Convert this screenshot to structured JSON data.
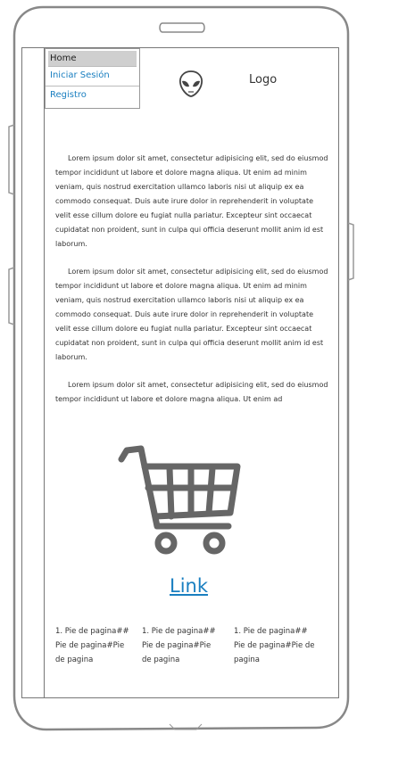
{
  "menu": {
    "items": [
      {
        "label": "Home"
      },
      {
        "label": "Iniciar Sesión"
      },
      {
        "label": "Registro"
      }
    ]
  },
  "header": {
    "logo_text": "Logo",
    "logo_icon": "alien-icon"
  },
  "main": {
    "paragraphs": [
      "Lorem ipsum dolor sit amet, consectetur adipisicing elit, sed do eiusmod tempor incididunt ut labore et dolore magna aliqua. Ut enim ad minim veniam, quis nostrud exercitation ullamco laboris nisi ut aliquip ex ea commodo consequat. Duis aute irure dolor in reprehenderit in voluptate velit esse cillum dolore eu fugiat nulla pariatur. Excepteur sint occaecat cupidatat non proident, sunt in culpa qui officia deserunt mollit anim id est laborum.",
      "Lorem ipsum dolor sit amet, consectetur adipisicing elit, sed do eiusmod tempor incididunt ut labore et dolore magna aliqua. Ut enim ad minim veniam, quis nostrud exercitation ullamco laboris nisi ut aliquip ex ea commodo consequat. Duis aute irure dolor in reprehenderit in voluptate velit esse cillum dolore eu fugiat nulla pariatur. Excepteur sint occaecat cupidatat non proident, sunt in culpa qui officia deserunt mollit anim id est laborum.",
      "Lorem ipsum dolor sit amet, consectetur adipisicing elit, sed do eiusmod tempor incididunt ut labore et dolore magna aliqua. Ut enim ad"
    ],
    "cart_icon": "shopping-cart-icon",
    "link_label": "Link"
  },
  "footer": {
    "columns": [
      "1. Pie de pagina## Pie de pagina#Pie de pagina",
      "1. Pie de pagina## Pie de pagina#Pie de pagina",
      "1. Pie de pagina## Pie de pagina#Pie de pagina"
    ]
  },
  "colors": {
    "link": "#1a7fc0",
    "menu_active": "#cfcfcf",
    "outline": "#777777"
  }
}
